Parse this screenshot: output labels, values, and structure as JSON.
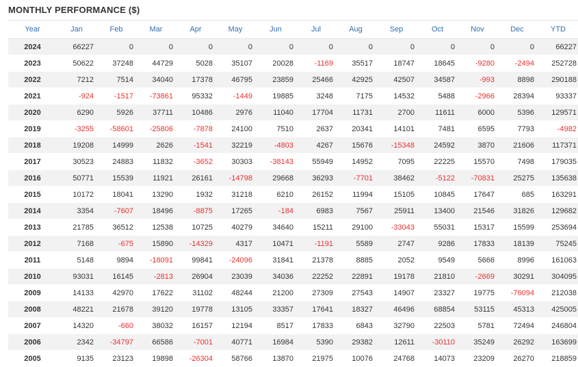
{
  "title": "MONTHLY PERFORMANCE ($)",
  "negative_color": "#e8302d",
  "header_color": "#2f6fb2",
  "columns": [
    "Year",
    "Jan",
    "Feb",
    "Mar",
    "Apr",
    "May",
    "Jun",
    "Jul",
    "Aug",
    "Sep",
    "Oct",
    "Nov",
    "Dec",
    "YTD"
  ],
  "rows": [
    [
      "2024",
      "66227",
      "0",
      "0",
      "0",
      "0",
      "0",
      "0",
      "0",
      "0",
      "0",
      "0",
      "0",
      "66227"
    ],
    [
      "2023",
      "50622",
      "37248",
      "44729",
      "5028",
      "35107",
      "20028",
      "-1169",
      "35517",
      "18747",
      "18645",
      "-9280",
      "-2494",
      "252728"
    ],
    [
      "2022",
      "7212",
      "7514",
      "34040",
      "17378",
      "46795",
      "23859",
      "25466",
      "42925",
      "42507",
      "34587",
      "-993",
      "8898",
      "290188"
    ],
    [
      "2021",
      "-924",
      "-1517",
      "-73861",
      "95332",
      "-1449",
      "19885",
      "3248",
      "7175",
      "14532",
      "5488",
      "-2966",
      "28394",
      "93337"
    ],
    [
      "2020",
      "6290",
      "5926",
      "37711",
      "10486",
      "2976",
      "11040",
      "17704",
      "11731",
      "2700",
      "11611",
      "6000",
      "5396",
      "129571"
    ],
    [
      "2019",
      "-3255",
      "-58601",
      "-25806",
      "-7878",
      "24100",
      "7510",
      "2637",
      "20341",
      "14101",
      "7481",
      "6595",
      "7793",
      "-4982"
    ],
    [
      "2018",
      "19208",
      "14999",
      "2626",
      "-1541",
      "32219",
      "-4803",
      "4267",
      "15676",
      "-15348",
      "24592",
      "3870",
      "21606",
      "117371"
    ],
    [
      "2017",
      "30523",
      "24883",
      "11832",
      "-3652",
      "30303",
      "-38143",
      "55949",
      "14952",
      "7095",
      "22225",
      "15570",
      "7498",
      "179035"
    ],
    [
      "2016",
      "50771",
      "15539",
      "11921",
      "26161",
      "-14798",
      "29668",
      "36293",
      "-7701",
      "38462",
      "-5122",
      "-70831",
      "25275",
      "135638"
    ],
    [
      "2015",
      "10172",
      "18041",
      "13290",
      "1932",
      "31218",
      "6210",
      "26152",
      "11994",
      "15105",
      "10845",
      "17647",
      "685",
      "163291"
    ],
    [
      "2014",
      "3354",
      "-7607",
      "18496",
      "-8875",
      "17265",
      "-184",
      "6983",
      "7567",
      "25911",
      "13400",
      "21546",
      "31826",
      "129682"
    ],
    [
      "2013",
      "21785",
      "36512",
      "12538",
      "10725",
      "40279",
      "34640",
      "15211",
      "29100",
      "-33043",
      "55031",
      "15317",
      "15599",
      "253694"
    ],
    [
      "2012",
      "7168",
      "-675",
      "15890",
      "-14329",
      "4317",
      "10471",
      "-1191",
      "5589",
      "2747",
      "9286",
      "17833",
      "18139",
      "75245"
    ],
    [
      "2011",
      "5148",
      "9894",
      "-18091",
      "99841",
      "-24096",
      "31841",
      "21378",
      "8885",
      "2052",
      "9549",
      "5666",
      "8996",
      "161063"
    ],
    [
      "2010",
      "93031",
      "16145",
      "-2813",
      "26904",
      "23039",
      "34036",
      "22252",
      "22891",
      "19178",
      "21810",
      "-2669",
      "30291",
      "304095"
    ],
    [
      "2009",
      "14133",
      "42970",
      "17622",
      "31102",
      "48244",
      "21200",
      "27309",
      "27543",
      "14907",
      "23327",
      "19775",
      "-76094",
      "212038"
    ],
    [
      "2008",
      "48221",
      "21678",
      "39120",
      "19778",
      "13105",
      "33357",
      "17641",
      "18327",
      "46496",
      "68854",
      "53115",
      "45313",
      "425005"
    ],
    [
      "2007",
      "14320",
      "-660",
      "38032",
      "16157",
      "12194",
      "8517",
      "17833",
      "6843",
      "32790",
      "22503",
      "5781",
      "72494",
      "246804"
    ],
    [
      "2006",
      "2342",
      "-34797",
      "66586",
      "-7001",
      "40771",
      "16984",
      "5390",
      "29382",
      "12611",
      "-30110",
      "35249",
      "26292",
      "163699"
    ],
    [
      "2005",
      "9135",
      "23123",
      "19898",
      "-26304",
      "58766",
      "13870",
      "21975",
      "10076",
      "24768",
      "14073",
      "23209",
      "26270",
      "218859"
    ]
  ]
}
